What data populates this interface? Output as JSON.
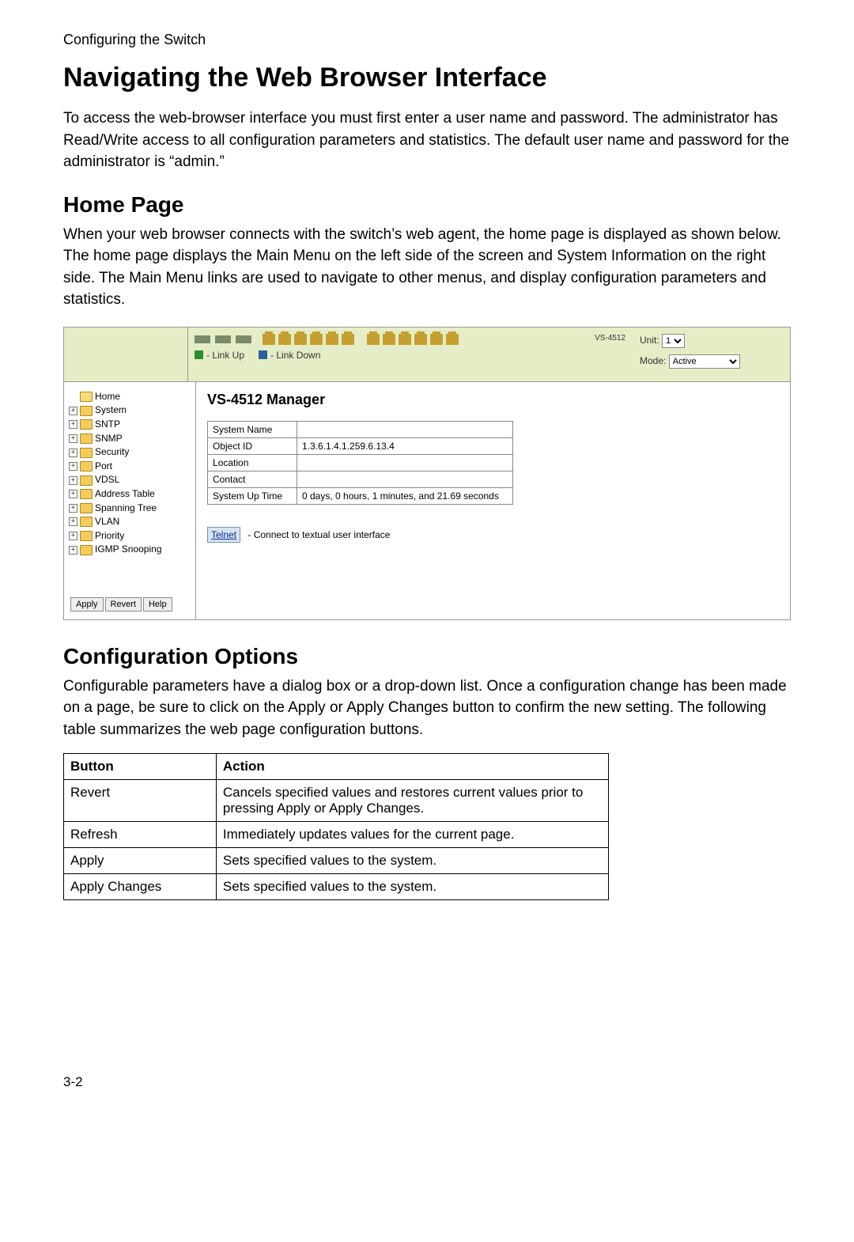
{
  "breadcrumb": "Configuring the Switch",
  "title": "Navigating the Web Browser Interface",
  "intro": "To access the web-browser interface you must first enter a user name and password. The administrator has Read/Write access to all configuration parameters and statistics. The default user name and password for the administrator is “admin.”",
  "home_heading": "Home Page",
  "home_text": "When your web browser connects with the switch’s web agent, the home page is displayed as shown below. The home page displays the Main Menu on the left side of the screen and System Information on the right side. The Main Menu links are used to navigate to other menus, and display configuration parameters and statistics.",
  "screenshot": {
    "model": "VS-4512",
    "legend_up": "- Link Up",
    "legend_down": "- Link Down",
    "unit_label": "Unit:",
    "unit_value": "1",
    "mode_label": "Mode:",
    "mode_value": "Active",
    "tree": [
      {
        "label": "Home",
        "root": true
      },
      {
        "label": "System"
      },
      {
        "label": "SNTP"
      },
      {
        "label": "SNMP"
      },
      {
        "label": "Security"
      },
      {
        "label": "Port"
      },
      {
        "label": "VDSL"
      },
      {
        "label": "Address Table"
      },
      {
        "label": "Spanning Tree"
      },
      {
        "label": "VLAN"
      },
      {
        "label": "Priority"
      },
      {
        "label": "IGMP Snooping"
      }
    ],
    "buttons": {
      "apply": "Apply",
      "revert": "Revert",
      "help": "Help"
    },
    "main_title": "VS-4512 Manager",
    "rows": [
      {
        "k": "System Name",
        "v": ""
      },
      {
        "k": "Object ID",
        "v": "1.3.6.1.4.1.259.6.13.4"
      },
      {
        "k": "Location",
        "v": ""
      },
      {
        "k": "Contact",
        "v": ""
      },
      {
        "k": "System Up Time",
        "v": "0 days, 0 hours, 1 minutes, and 21.69 seconds"
      }
    ],
    "telnet_btn": "Telnet",
    "telnet_text": " - Connect to textual user interface"
  },
  "cfg_heading": "Configuration Options",
  "cfg_text": "Configurable parameters have a dialog box or a drop-down list. Once a configuration change has been made on a page, be sure to click on the Apply or Apply Changes button to confirm the new setting. The following table summarizes the web page configuration buttons.",
  "cfg_table": {
    "h1": "Button",
    "h2": "Action",
    "rows": [
      {
        "b": "Revert",
        "a": "Cancels specified values and restores current values prior to pressing Apply or Apply Changes."
      },
      {
        "b": "Refresh",
        "a": "Immediately updates values for the current page."
      },
      {
        "b": "Apply",
        "a": "Sets specified values to the system."
      },
      {
        "b": "Apply Changes",
        "a": "Sets specified values to the system."
      }
    ]
  },
  "page_number": "3-2"
}
